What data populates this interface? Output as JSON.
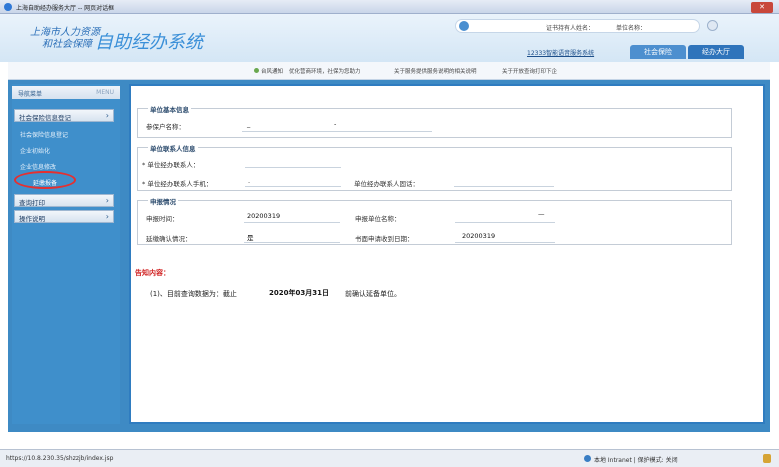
{
  "window": {
    "title": "上海自助经办服务大厅 -- 网页对话框"
  },
  "header": {
    "logo_line1": "上海市人力资源",
    "logo_line2": "和社会保障",
    "logo_system": "自助经办系统",
    "cert_holder_label": "证书持有人姓名：",
    "company_name_label": "单位名称：",
    "hotline_link": "12333智能语音服务系统",
    "tab_social_security": "社会保险",
    "tab_service_hall": "经办大厅"
  },
  "subnav": [
    "台风通知",
    "优化营商环境，社保为您助力",
    "关于服务提供服务说明的相关说明",
    "关于开放查询打印下企"
  ],
  "sidebar": {
    "title": "导航菜单",
    "menu_label": "MENU",
    "groups": [
      {
        "label": "社会保险信息登记",
        "items": [
          "社会保险信息登记",
          "企业初始化",
          "企业信息修改",
          "延缴报备"
        ]
      },
      {
        "label": "查询打印",
        "items": []
      },
      {
        "label": "操作说明",
        "items": []
      }
    ]
  },
  "unit_basic": {
    "legend": "单位基本信息",
    "insured_name_label": "参保户名称：",
    "insured_name_value": "_",
    "insured_name_value2": "-"
  },
  "unit_contact": {
    "legend": "单位联系人信息",
    "contact_label": "* 单位经办联系人：",
    "mobile_label": "* 单位经办联系人手机：",
    "mobile_value": ".",
    "phone_label": "单位经办联系人固话："
  },
  "declaration": {
    "legend": "申报情况",
    "date_label": "申报时间：",
    "date_value": "20200319",
    "company_label": "申报单位名称：",
    "company_value": "—",
    "confirm_label": "延缴确认情况：",
    "confirm_value": "是",
    "receipt_label": "书面申请收到日期：",
    "receipt_value": "20200319"
  },
  "notice": {
    "title": "告知内容：",
    "line_prefix": "(1)、目前查询数据为：截止",
    "line_date": "2020年03月31日",
    "line_suffix": "前确认延备单位。"
  },
  "statusbar": {
    "url": "https://10.8.230.35/shzzjb/index.jsp",
    "zone": "本地 Intranet | 保护模式: 关闭"
  }
}
